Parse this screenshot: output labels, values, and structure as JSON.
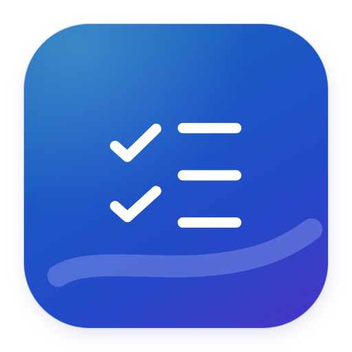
{
  "app_icon": {
    "name": "checklist",
    "glyph": "checklist-icon",
    "colors": {
      "gradient_start": "#1f74b8",
      "gradient_mid": "#1b58c4",
      "gradient_end": "#4a34c4",
      "glyph": "#ffffff",
      "swoosh": "#6a7fe0"
    },
    "items": [
      {
        "checked": true
      },
      {
        "checked": true
      },
      {
        "checked": false
      }
    ]
  }
}
